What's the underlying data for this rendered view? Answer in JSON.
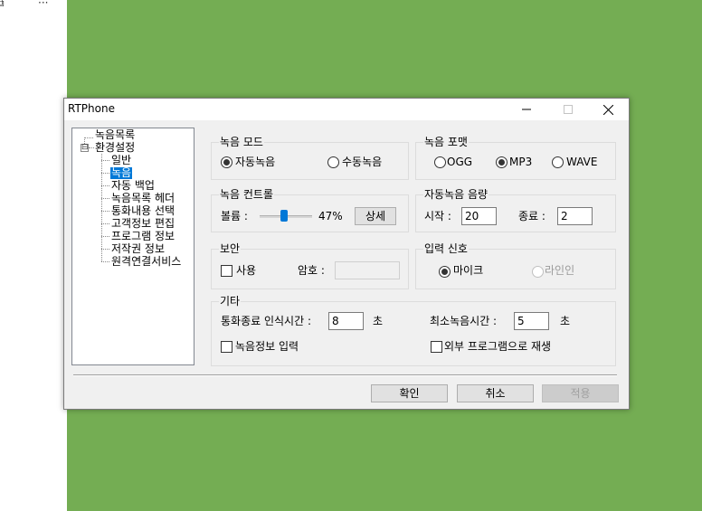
{
  "background": {
    "desktop_color": "#74ad53",
    "strip_icons": [
      "window-icon",
      "ellipsis-icon"
    ]
  },
  "window": {
    "title": "RTPhone"
  },
  "tree": {
    "items": [
      {
        "label": "녹음목록",
        "selected": false
      },
      {
        "label": "환경설정",
        "selected": false
      },
      {
        "label": "일반",
        "selected": false
      },
      {
        "label": "녹음",
        "selected": true
      },
      {
        "label": "자동 백업",
        "selected": false
      },
      {
        "label": "녹음목록 헤더",
        "selected": false
      },
      {
        "label": "통화내용 선택",
        "selected": false
      },
      {
        "label": "고객정보 편집",
        "selected": false
      },
      {
        "label": "프로그램 정보",
        "selected": false
      },
      {
        "label": "저작권 정보",
        "selected": false
      },
      {
        "label": "원격연결서비스",
        "selected": false
      }
    ],
    "expander": "⊟"
  },
  "record_mode": {
    "title": "녹음 모드",
    "options": [
      "자동녹음",
      "수동녹음"
    ],
    "selected": "자동녹음"
  },
  "record_format": {
    "title": "녹음 포맷",
    "options": [
      "OGG",
      "MP3",
      "WAVE"
    ],
    "selected": "MP3"
  },
  "record_control": {
    "title": "녹음 컨트롤",
    "volume_label": "볼륨 :",
    "volume_value": "47%",
    "volume_level": 0.47,
    "detail_button": "상세"
  },
  "auto_volume": {
    "title": "자동녹음 음량",
    "start_label": "시작 :",
    "start_value": "20",
    "end_label": "종료 :",
    "end_value": "2"
  },
  "security": {
    "title": "보안",
    "use_label": "사용",
    "use_checked": false,
    "password_label": "암호 :",
    "password_value": ""
  },
  "input_signal": {
    "title": "입력 신호",
    "options": [
      "마이크",
      "라인인"
    ],
    "selected": "마이크"
  },
  "etc": {
    "title": "기타",
    "hangup_label": "통화종료 인식시간 :",
    "hangup_value": "8",
    "hangup_unit": "초",
    "min_record_label": "최소녹음시간 :",
    "min_record_value": "5",
    "min_record_unit": "초",
    "record_info_label": "녹음정보 입력",
    "record_info_checked": false,
    "external_label": "외부 프로그램으로 재생",
    "external_checked": false
  },
  "buttons": {
    "ok": "확인",
    "cancel": "취소",
    "apply": "적용"
  }
}
